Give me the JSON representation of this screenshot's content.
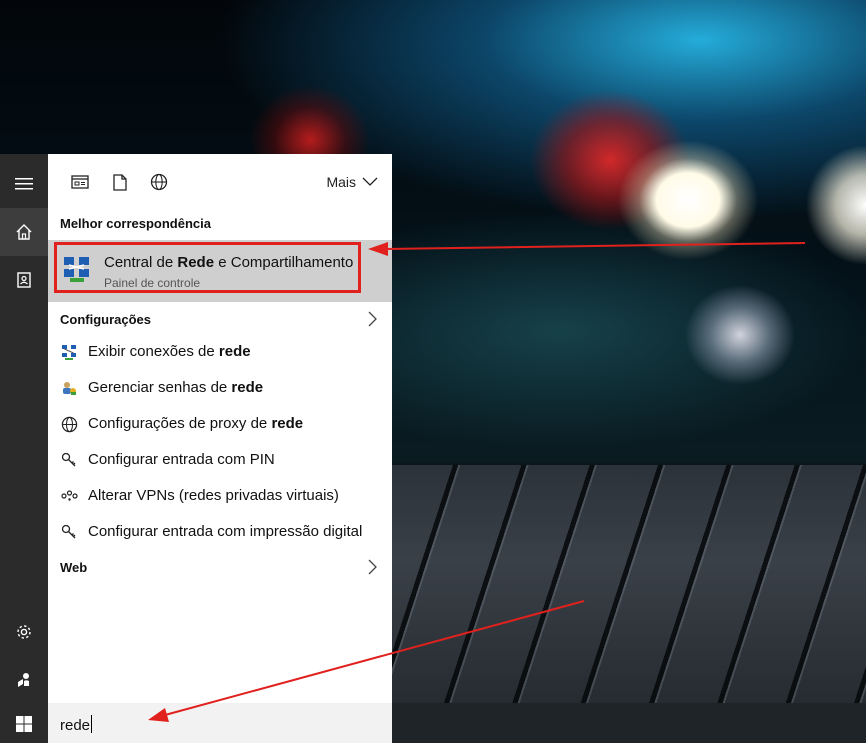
{
  "toolbar": {
    "more_label": "Mais",
    "icons": [
      "apps-filter-icon",
      "documents-filter-icon",
      "web-filter-icon"
    ]
  },
  "best_match": {
    "section_label": "Melhor correspondência",
    "title_pre": "Central de ",
    "title_bold": "Rede",
    "title_post": " e Compartilhamento",
    "subtitle": "Painel de controle",
    "icon": "network-sharing-center-icon"
  },
  "settings": {
    "section_label": "Configurações",
    "items": [
      {
        "pre": "Exibir conexões de ",
        "bold": "rede",
        "post": "",
        "icon": "network-connections-icon"
      },
      {
        "pre": "Gerenciar senhas de ",
        "bold": "rede",
        "post": "",
        "icon": "credential-manager-icon"
      },
      {
        "pre": "Configurações de proxy de ",
        "bold": "rede",
        "post": "",
        "icon": "globe-icon"
      },
      {
        "pre": "Configurar entrada com PIN",
        "bold": "",
        "post": "",
        "icon": "key-icon"
      },
      {
        "pre": "Alterar VPNs (redes privadas virtuais)",
        "bold": "",
        "post": "",
        "icon": "vpn-icon"
      },
      {
        "pre": "Configurar entrada com impressão digital",
        "bold": "",
        "post": "",
        "icon": "key-icon"
      }
    ]
  },
  "web": {
    "section_label": "Web"
  },
  "search": {
    "query": "rede"
  },
  "colors": {
    "annotation_red": "#e0211d",
    "highlight_bg": "#cfcfcf",
    "rail_bg": "#2b2b2b"
  }
}
